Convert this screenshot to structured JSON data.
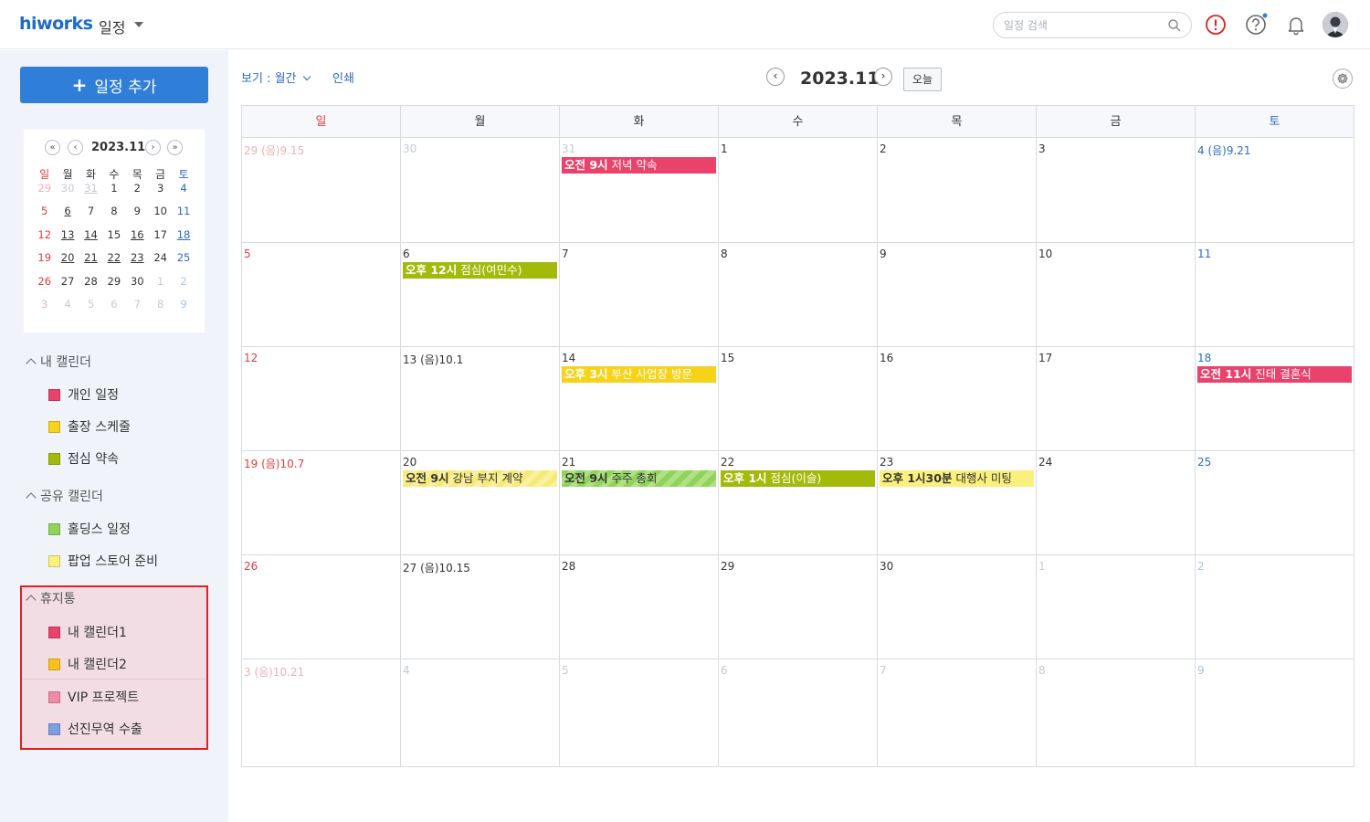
{
  "header": {
    "logo": "hiworks",
    "app_name": "일정",
    "search_placeholder": "일정 검색"
  },
  "sidebar": {
    "add_button_label": "일정 추가",
    "mini_calendar": {
      "title": "2023.11",
      "weekdays": [
        "일",
        "월",
        "화",
        "수",
        "목",
        "금",
        "토"
      ],
      "weeks": [
        [
          "29",
          "30",
          "31",
          "1",
          "2",
          "3",
          "4"
        ],
        [
          "5",
          "6",
          "7",
          "8",
          "9",
          "10",
          "11"
        ],
        [
          "12",
          "13",
          "14",
          "15",
          "16",
          "17",
          "18"
        ],
        [
          "19",
          "20",
          "21",
          "22",
          "23",
          "24",
          "25"
        ],
        [
          "26",
          "27",
          "28",
          "29",
          "30",
          "1",
          "2"
        ],
        [
          "3",
          "4",
          "5",
          "6",
          "7",
          "8",
          "9"
        ]
      ]
    },
    "my_calendars": {
      "title": "내 캘린더",
      "items": [
        {
          "label": "개인 일정",
          "color": "#e9436b"
        },
        {
          "label": "출장 스케줄",
          "color": "#f7d21b"
        },
        {
          "label": "점심 약속",
          "color": "#a4ba0a"
        }
      ]
    },
    "shared_calendars": {
      "title": "공유 캘린더",
      "items": [
        {
          "label": "홀딩스 일정",
          "color": "#8fd35a"
        },
        {
          "label": "팝업 스토어 준비",
          "color": "#f9f07d"
        }
      ]
    },
    "trash": {
      "title": "휴지통",
      "items": [
        {
          "label": "내 캘린더1",
          "color": "#e9436b"
        },
        {
          "label": "내 캘린더2",
          "color": "#f7c21b"
        },
        {
          "label": "VIP 프로젝트",
          "color": "#f08aa6"
        },
        {
          "label": "선진무역 수출",
          "color": "#7d9ee0"
        }
      ]
    }
  },
  "toolbar": {
    "view_label": "보기 : 월간",
    "print_label": "인쇄",
    "month_title": "2023.11",
    "today_label": "오늘"
  },
  "calendar": {
    "weekdays": [
      "일",
      "월",
      "화",
      "수",
      "목",
      "금",
      "토"
    ],
    "weeks": [
      [
        {
          "day": "29 (음)9.15",
          "dim": true
        },
        {
          "day": "30",
          "dim": true
        },
        {
          "day": "31",
          "dim": true,
          "event": {
            "time": "오전 9시",
            "title": "저녁 약속",
            "style": "ev-red"
          }
        },
        {
          "day": "1"
        },
        {
          "day": "2"
        },
        {
          "day": "3"
        },
        {
          "day": "4 (음)9.21"
        }
      ],
      [
        {
          "day": "5"
        },
        {
          "day": "6",
          "event": {
            "time": "오후 12시",
            "title": "점심(여민수)",
            "style": "ev-olive"
          }
        },
        {
          "day": "7"
        },
        {
          "day": "8"
        },
        {
          "day": "9"
        },
        {
          "day": "10"
        },
        {
          "day": "11"
        }
      ],
      [
        {
          "day": "12"
        },
        {
          "day": "13 (음)10.1"
        },
        {
          "day": "14",
          "event": {
            "time": "오후 3시",
            "title": "부산 사업장 방문",
            "style": "ev-yellow"
          }
        },
        {
          "day": "15"
        },
        {
          "day": "16"
        },
        {
          "day": "17"
        },
        {
          "day": "18",
          "event": {
            "time": "오전 11시",
            "title": "진태 결혼식",
            "style": "ev-red"
          }
        }
      ],
      [
        {
          "day": "19 (음)10.7"
        },
        {
          "day": "20",
          "event": {
            "time": "오전 9시",
            "title": "강남 부지 계약",
            "style": "ev-striped-yellow"
          }
        },
        {
          "day": "21",
          "event": {
            "time": "오전 9시",
            "title": "주주 총회",
            "style": "ev-striped-green"
          }
        },
        {
          "day": "22",
          "event": {
            "time": "오후 1시",
            "title": "점심(이슬)",
            "style": "ev-olive"
          }
        },
        {
          "day": "23",
          "event": {
            "time": "오후 1시30분",
            "title": "대행사 미팅",
            "style": "ev-light-yellow"
          }
        },
        {
          "day": "24"
        },
        {
          "day": "25"
        }
      ],
      [
        {
          "day": "26"
        },
        {
          "day": "27 (음)10.15"
        },
        {
          "day": "28"
        },
        {
          "day": "29"
        },
        {
          "day": "30"
        },
        {
          "day": "1",
          "dim": true
        },
        {
          "day": "2",
          "dim": true
        }
      ],
      [
        {
          "day": "3 (음)10.21",
          "dim": true
        },
        {
          "day": "4",
          "dim": true
        },
        {
          "day": "5",
          "dim": true
        },
        {
          "day": "6",
          "dim": true
        },
        {
          "day": "7",
          "dim": true
        },
        {
          "day": "8",
          "dim": true
        },
        {
          "day": "9",
          "dim": true
        }
      ]
    ]
  },
  "colors": {
    "accent": "#2f7fd9",
    "sunday": "#e33b3b",
    "saturday": "#2c6bbf",
    "trash_highlight": "#e02020"
  }
}
